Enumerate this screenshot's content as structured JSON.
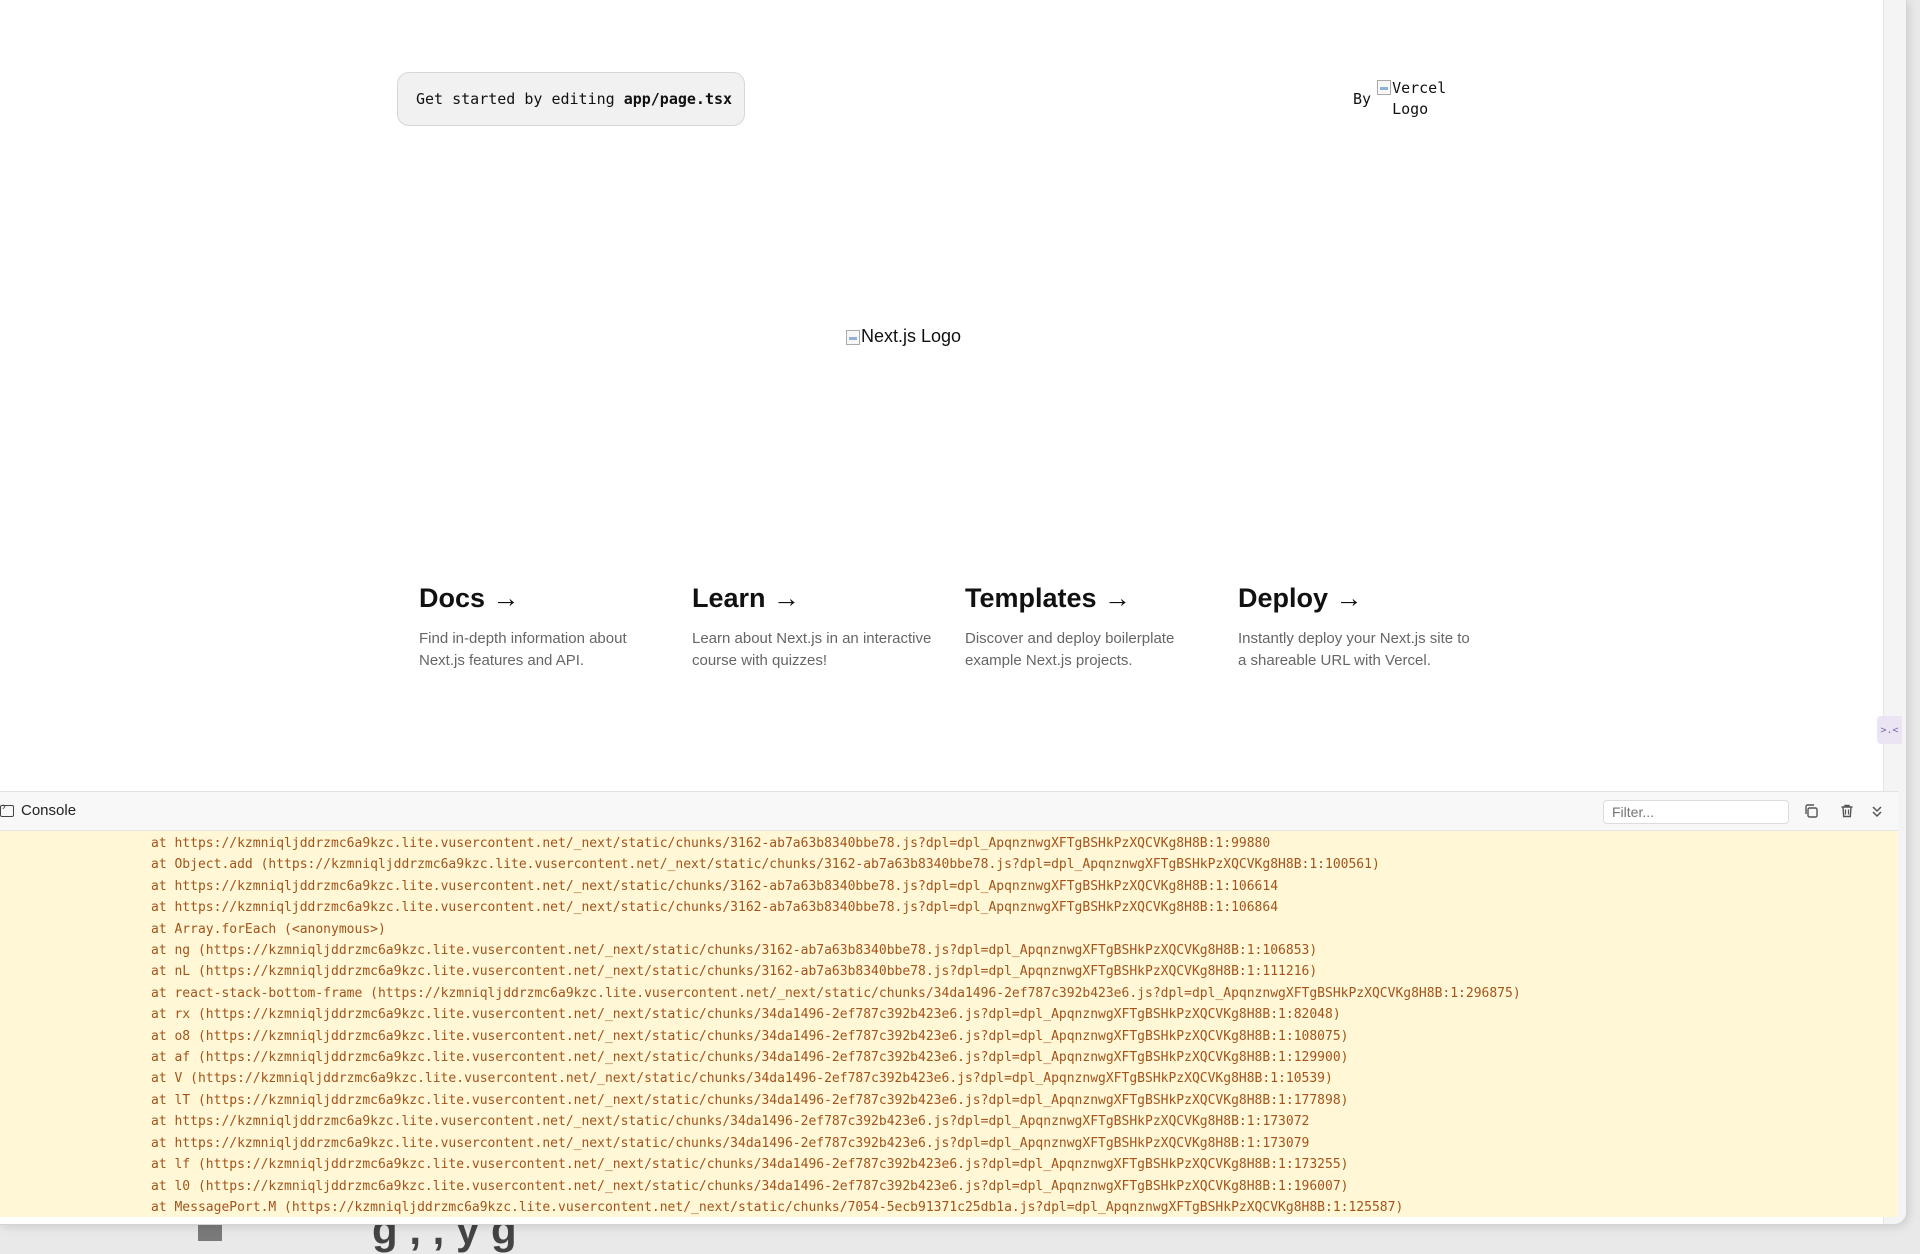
{
  "page": {
    "get_started_prefix": "Get started by editing",
    "get_started_file": "app/page.tsx",
    "by_label": "By",
    "vercel_alt": "Vercel Logo",
    "nextjs_alt": "Next.js Logo"
  },
  "cards": [
    {
      "title": "Docs →",
      "description": "Find in-depth information about Next.js features and API."
    },
    {
      "title": "Learn →",
      "description": "Learn about Next.js in an interactive course with quizzes!"
    },
    {
      "title": "Templates →",
      "description": "Discover and deploy boilerplate example Next.js projects."
    },
    {
      "title": "Deploy →",
      "description": "Instantly deploy your Next.js site to a shareable URL with Vercel."
    }
  ],
  "side_widget_label": ">.<",
  "console": {
    "title": "Console",
    "filter_placeholder": "Filter...",
    "lines": [
      "at https://kzmniqljddrzmc6a9kzc.lite.vusercontent.net/_next/static/chunks/3162-ab7a63b8340bbe78.js?dpl=dpl_ApqnznwgXFTgBSHkPzXQCVKg8H8B:1:99880",
      "at Object.add (https://kzmniqljddrzmc6a9kzc.lite.vusercontent.net/_next/static/chunks/3162-ab7a63b8340bbe78.js?dpl=dpl_ApqnznwgXFTgBSHkPzXQCVKg8H8B:1:100561)",
      "at https://kzmniqljddrzmc6a9kzc.lite.vusercontent.net/_next/static/chunks/3162-ab7a63b8340bbe78.js?dpl=dpl_ApqnznwgXFTgBSHkPzXQCVKg8H8B:1:106614",
      "at https://kzmniqljddrzmc6a9kzc.lite.vusercontent.net/_next/static/chunks/3162-ab7a63b8340bbe78.js?dpl=dpl_ApqnznwgXFTgBSHkPzXQCVKg8H8B:1:106864",
      "at Array.forEach (<anonymous>)",
      "at ng (https://kzmniqljddrzmc6a9kzc.lite.vusercontent.net/_next/static/chunks/3162-ab7a63b8340bbe78.js?dpl=dpl_ApqnznwgXFTgBSHkPzXQCVKg8H8B:1:106853)",
      "at nL (https://kzmniqljddrzmc6a9kzc.lite.vusercontent.net/_next/static/chunks/3162-ab7a63b8340bbe78.js?dpl=dpl_ApqnznwgXFTgBSHkPzXQCVKg8H8B:1:111216)",
      "at react-stack-bottom-frame (https://kzmniqljddrzmc6a9kzc.lite.vusercontent.net/_next/static/chunks/34da1496-2ef787c392b423e6.js?dpl=dpl_ApqnznwgXFTgBSHkPzXQCVKg8H8B:1:296875)",
      "at rx (https://kzmniqljddrzmc6a9kzc.lite.vusercontent.net/_next/static/chunks/34da1496-2ef787c392b423e6.js?dpl=dpl_ApqnznwgXFTgBSHkPzXQCVKg8H8B:1:82048)",
      "at o8 (https://kzmniqljddrzmc6a9kzc.lite.vusercontent.net/_next/static/chunks/34da1496-2ef787c392b423e6.js?dpl=dpl_ApqnznwgXFTgBSHkPzXQCVKg8H8B:1:108075)",
      "at af (https://kzmniqljddrzmc6a9kzc.lite.vusercontent.net/_next/static/chunks/34da1496-2ef787c392b423e6.js?dpl=dpl_ApqnznwgXFTgBSHkPzXQCVKg8H8B:1:129900)",
      "at V (https://kzmniqljddrzmc6a9kzc.lite.vusercontent.net/_next/static/chunks/34da1496-2ef787c392b423e6.js?dpl=dpl_ApqnznwgXFTgBSHkPzXQCVKg8H8B:1:10539)",
      "at lT (https://kzmniqljddrzmc6a9kzc.lite.vusercontent.net/_next/static/chunks/34da1496-2ef787c392b423e6.js?dpl=dpl_ApqnznwgXFTgBSHkPzXQCVKg8H8B:1:177898)",
      "at https://kzmniqljddrzmc6a9kzc.lite.vusercontent.net/_next/static/chunks/34da1496-2ef787c392b423e6.js?dpl=dpl_ApqnznwgXFTgBSHkPzXQCVKg8H8B:1:173072",
      "at https://kzmniqljddrzmc6a9kzc.lite.vusercontent.net/_next/static/chunks/34da1496-2ef787c392b423e6.js?dpl=dpl_ApqnznwgXFTgBSHkPzXQCVKg8H8B:1:173079",
      "at lf (https://kzmniqljddrzmc6a9kzc.lite.vusercontent.net/_next/static/chunks/34da1496-2ef787c392b423e6.js?dpl=dpl_ApqnznwgXFTgBSHkPzXQCVKg8H8B:1:173255)",
      "at l0 (https://kzmniqljddrzmc6a9kzc.lite.vusercontent.net/_next/static/chunks/34da1496-2ef787c392b423e6.js?dpl=dpl_ApqnznwgXFTgBSHkPzXQCVKg8H8B:1:196007)",
      "at MessagePort.M (https://kzmniqljddrzmc6a9kzc.lite.vusercontent.net/_next/static/chunks/7054-5ecb91371c25db1a.js?dpl=dpl_ApqnznwgXFTgBSHkPzXQCVKg8H8B:1:125587)"
    ]
  },
  "colors": {
    "console_bg": "#fff7d6",
    "console_text": "#a3541a",
    "card_title": "#111111",
    "card_desc": "#666666"
  }
}
